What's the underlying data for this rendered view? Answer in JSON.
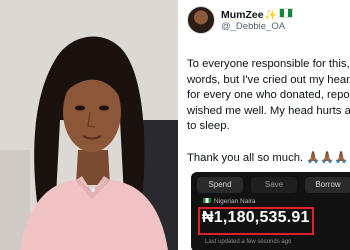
{
  "tweet": {
    "display_name": "MumZee",
    "handle": "@_Debbie_OA",
    "body_lines": [
      "To everyone responsible for this, I",
      "words, but I've cried out my heart",
      "for every one who donated, repos",
      "wished me well. My head hurts an",
      "to sleep."
    ],
    "thanks": "Thank you all so much. 🙏🏾🙏🏾🙏🏾"
  },
  "wallet": {
    "buttons": [
      "Spend",
      "Save",
      "Borrow"
    ],
    "currency_label": "Nigerian Naira",
    "balance": "₦1,180,535.91",
    "updated": "Last updated a few seconds ago"
  },
  "colors": {
    "highlight_border": "#e0202a",
    "wallet_background": "#121212"
  }
}
